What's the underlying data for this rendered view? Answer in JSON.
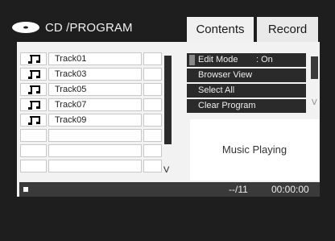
{
  "header": {
    "title": "CD /PROGRAM",
    "tabs": [
      "Contents",
      "Record"
    ]
  },
  "tracks": [
    "Track01",
    "Track03",
    "Track05",
    "Track07",
    "Track09",
    "",
    "",
    ""
  ],
  "list_scroll_marker": "V",
  "menu": {
    "items": [
      {
        "label": "Edit Mode",
        "value": ": On"
      },
      {
        "label": "Browser View",
        "value": ""
      },
      {
        "label": "Select All",
        "value": ""
      },
      {
        "label": "Clear Program",
        "value": ""
      }
    ],
    "scroll_marker": "V"
  },
  "status": "Music Playing",
  "bottom": {
    "track_count": "--/11",
    "time": "00:00:00"
  }
}
